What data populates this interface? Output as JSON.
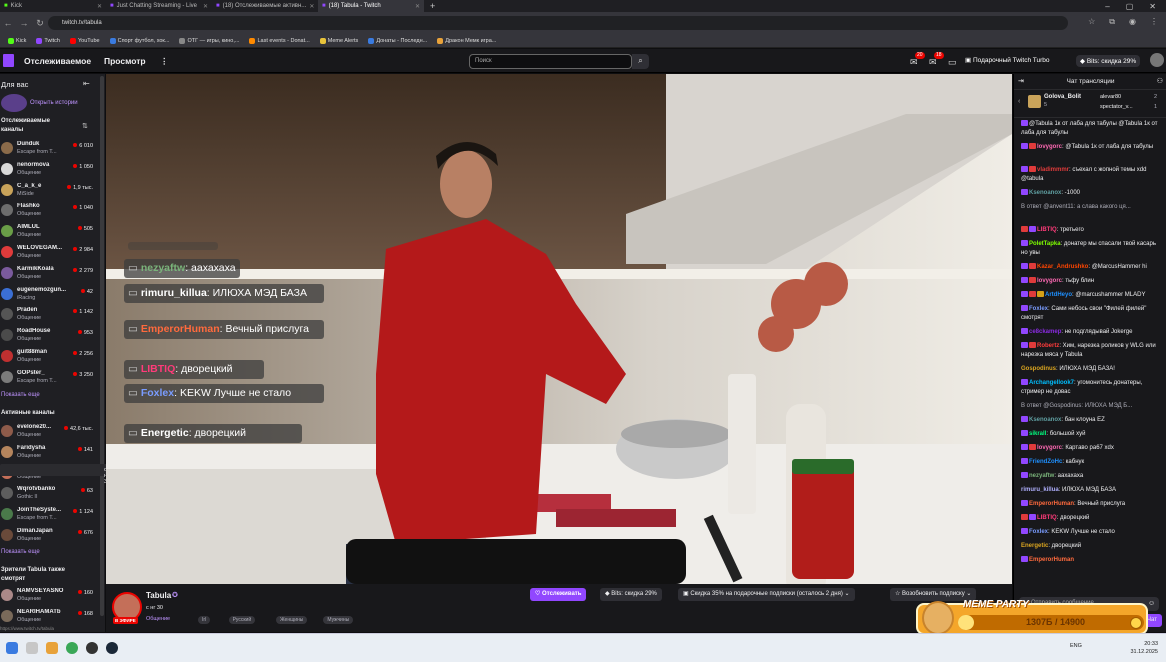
{
  "browser": {
    "tabs": [
      {
        "label": "Kick",
        "active": false
      },
      {
        "label": "Just Chatting Streaming - Live",
        "active": false
      },
      {
        "label": "(18) Отслеживаемые активн...",
        "active": false
      },
      {
        "label": "(18) Tabula - Twitch",
        "active": true
      }
    ],
    "url": "twitch.tv/tabula",
    "bookmarks": [
      "Kick",
      "Twitch",
      "YouTube",
      "Спорт футбол, хок...",
      "ОТГ — игры, кино,...",
      "Last events - Donat...",
      "Meme Alerts",
      "Донаты - Последн...",
      "Дракон Мемк игра..."
    ]
  },
  "topnav": {
    "following": "Отслеживаемое",
    "browse": "Просмотр",
    "more": "⋮",
    "search_placeholder": "Поиск",
    "badge1": "20",
    "badge2": "18",
    "turbo": "Подарочный Twitch Turbo",
    "bits": "Bits: скидка 29%"
  },
  "sidebar": {
    "for_you": "Для вас",
    "collapse": "⇤",
    "open_history": "Открыть истории",
    "followed_title": "Отслеживаемые каналы",
    "followed": [
      {
        "name": "Dunduk",
        "game": "Escape from T...",
        "viewers": "6 010",
        "color": "#8b6b4a"
      },
      {
        "name": "nenormova",
        "game": "Общение",
        "viewers": "1 050",
        "color": "#d9d9d9"
      },
      {
        "name": "C_a_k_e",
        "game": "MiSide",
        "viewers": "1,9 тыс.",
        "color": "#c9a35a"
      },
      {
        "name": "Flashko",
        "game": "Общение",
        "viewers": "1 040",
        "color": "#6d6d6d"
      },
      {
        "name": "AIMLUL",
        "game": "Общение",
        "viewers": "505",
        "color": "#6a9e47"
      },
      {
        "name": "WELOVEGAM...",
        "game": "Общение",
        "viewers": "2 984",
        "color": "#e03b3b"
      },
      {
        "name": "KarmikKoala",
        "game": "Общение",
        "viewers": "2 279",
        "color": "#7a5a9c"
      },
      {
        "name": "eugenemozgun...",
        "game": "iRacing",
        "viewers": "42",
        "color": "#3b6fd4"
      },
      {
        "name": "Praden",
        "game": "Общение",
        "viewers": "1 142",
        "color": "#555"
      },
      {
        "name": "RoadHouse",
        "game": "Общение",
        "viewers": "953",
        "color": "#4b4b4b"
      },
      {
        "name": "guit88man",
        "game": "Общение",
        "viewers": "2 256",
        "color": "#c03030"
      },
      {
        "name": "GOPster_",
        "game": "Escape from T...",
        "viewers": "3 250",
        "color": "#7b7b7b"
      }
    ],
    "show_more1": "Показать еще",
    "active_title": "Активные каналы",
    "active": [
      {
        "name": "evelone20...",
        "game": "Общение",
        "viewers": "42,6 тыс.",
        "color": "#8e5b4a"
      },
      {
        "name": "Faridysha",
        "game": "Общение",
        "viewers": "141",
        "color": "#b5855d"
      },
      {
        "name": "Tabula",
        "game": "Общение",
        "viewers": "269",
        "color": "#c46f59"
      },
      {
        "name": "Wqrotvbanko",
        "game": "Gothic II",
        "viewers": "63",
        "color": "#5d5d5d"
      },
      {
        "name": "JoinTheSyste...",
        "game": "Escape from T...",
        "viewers": "1 124",
        "color": "#4a7a4a"
      },
      {
        "name": "DimanJapan",
        "game": "Общение",
        "viewers": "676",
        "color": "#6a4a3a"
      }
    ],
    "tooltip": "с нг 30",
    "show_more2": "Показать еще",
    "viewers_title": "Зрители Tabula также смотрят",
    "also": [
      {
        "name": "NAMVSEYASNO",
        "game": "Общение",
        "viewers": "160",
        "color": "#a88"
      },
      {
        "name": "NEARIHAMATb",
        "game": "Общение",
        "viewers": "168",
        "color": "#7a6a5a"
      }
    ],
    "status_url": "https://www.twitch.tv/tabula"
  },
  "overlay_chat": [
    {
      "user": "nezyaftw",
      "text": ": аахахаха",
      "color": "#7ab37a"
    },
    {
      "user": "rimuru_killua",
      "text": ": ИЛЮХА МЭД БАЗА",
      "color": "#ffffff"
    },
    {
      "user": "EmperorHuman",
      "text": ": Вечный прислуга",
      "color": "#ff6a3d"
    },
    {
      "user": "LIBTIQ",
      "text": ": дворецкий",
      "color": "#ff3b7a"
    },
    {
      "user": "Foxlex",
      "text": ": KEKW Лучше не стало",
      "color": "#7a9cff"
    },
    {
      "user": "Energetic",
      "text": ": дворецкий",
      "color": "#ffffff"
    }
  ],
  "stream": {
    "streamer": "Tabula",
    "live": "В ЭФИРЕ",
    "title": "с нг 30",
    "category": "Общение",
    "tags": [
      "Irl",
      "Русский",
      "Женщины",
      "Мужчины"
    ],
    "follow": "Отслеживать",
    "bits_pill": "Bits: скидка 29%",
    "gift_pill": "Скидка 35% на подарочные подписки (осталось 2 дня)",
    "resume_pill": "Возобновить подписку"
  },
  "chat": {
    "header": "Чат трансляции",
    "leaders": [
      {
        "name": "Golova_Bolit",
        "count": "5"
      },
      {
        "name": "alevar80",
        "count": "2"
      },
      {
        "name": "spectator_v...",
        "count": "1"
      }
    ],
    "messages": [
      {
        "user": "",
        "text": "@Tabula 1к от лаба для табулы @Tabula 1к от лаба для табулы",
        "color": "#efeff1",
        "badges": [
          "#9147ff"
        ]
      },
      {
        "user": "lovygorc",
        "text": ": @Tabula 1к от лаба для табулы",
        "color": "#ff69b4",
        "badges": [
          "#9147ff",
          "#e03b3b"
        ]
      },
      {
        "user": "vladimmmr",
        "text": ": съехал с жопной темы xdd @tabula",
        "color": "#e03b3b",
        "badges": [
          "#9147ff",
          "#e03b3b"
        ]
      },
      {
        "user": "Ksenoanox",
        "text": ": -1000",
        "color": "#5f9ea0",
        "badges": [
          "#9147ff"
        ]
      },
      {
        "user": "",
        "text": "В ответ @anvent11: а слава какого ця...",
        "color": "#adadb8",
        "badges": []
      },
      {
        "user": "LIBTIQ",
        "text": ": третьего",
        "color": "#ff3b7a",
        "badges": [
          "#e03b3b",
          "#9147ff"
        ]
      },
      {
        "user": "PoletTapka",
        "text": ": донатер мы спасали твой касарь но увы",
        "color": "#7fff00",
        "badges": [
          "#9147ff"
        ]
      },
      {
        "user": "Kazar_Andrushko",
        "text": ": @MarcusHammer hi",
        "color": "#ff4500",
        "badges": [
          "#9147ff",
          "#e03b3b"
        ]
      },
      {
        "user": "lovygorc",
        "text": ": тьфу блин",
        "color": "#ff69b4",
        "badges": [
          "#9147ff",
          "#e03b3b"
        ]
      },
      {
        "user": "ArtdHeyo",
        "text": ": @marcushammer MLADY",
        "color": "#1e90ff",
        "badges": [
          "#9147ff",
          "#e03b3b",
          "#d4a017"
        ]
      },
      {
        "user": "Foxlex",
        "text": ": Сами небось свои \"Филей филей\" смотрят",
        "color": "#7a9cff",
        "badges": [
          "#9147ff"
        ]
      },
      {
        "user": "ce8ckamep",
        "text": ": не подглядывай Jokerge",
        "color": "#8a2be2",
        "badges": [
          "#9147ff"
        ]
      },
      {
        "user": "Robertz",
        "text": ": Хим, нарезка роликов у WLG или нарезка мяса у Tabula",
        "color": "#ff3b3b",
        "badges": [
          "#9147ff",
          "#e03b3b"
        ]
      },
      {
        "user": "Gospodinus",
        "text": ": ИЛЮХА МЭД БАЗА!",
        "color": "#daa520",
        "badges": []
      },
      {
        "user": "Archangellook7",
        "text": ": угомонитесь донатеры, стример не довас",
        "color": "#00bfff",
        "badges": [
          "#9147ff"
        ]
      },
      {
        "user": "",
        "text": "В ответ @Gospodinus: ИЛЮХА МЭД Б...",
        "color": "#adadb8",
        "badges": []
      },
      {
        "user": "Ksenoanox",
        "text": ": бан клоуна EZ",
        "color": "#5f9ea0",
        "badges": [
          "#9147ff"
        ]
      },
      {
        "user": "sikrall",
        "text": ": большой хуй",
        "color": "#00ff7f",
        "badges": [
          "#9147ff"
        ]
      },
      {
        "user": "lovygorc",
        "text": ": Картаво ра67 xdx",
        "color": "#ff69b4",
        "badges": [
          "#9147ff",
          "#e03b3b"
        ]
      },
      {
        "user": "FriendZoHc",
        "text": ": кабнук",
        "color": "#1e90ff",
        "badges": [
          "#9147ff"
        ]
      },
      {
        "user": "nezyaftw",
        "text": ": аахахаха",
        "color": "#7ab37a",
        "badges": [
          "#9147ff"
        ]
      },
      {
        "user": "rimuru_killua",
        "text": ": ИЛЮХА МЭД БАЗА",
        "color": "#b0b0ff",
        "badges": []
      },
      {
        "user": "EmperorHuman",
        "text": ": Вечный прислуга",
        "color": "#ff6a3d",
        "badges": [
          "#9147ff"
        ]
      },
      {
        "user": "LIBTIQ",
        "text": ": дворецкий",
        "color": "#ff3b7a",
        "badges": [
          "#e03b3b",
          "#9147ff"
        ]
      },
      {
        "user": "Foxlex",
        "text": ": KEKW Лучше не стало",
        "color": "#7a9cff",
        "badges": [
          "#9147ff"
        ]
      },
      {
        "user": "Energetic",
        "text": ": дворецкий",
        "color": "#daa520",
        "badges": []
      },
      {
        "user": "EmperorHuman",
        "text": "",
        "color": "#ff6a3d",
        "badges": [
          "#9147ff"
        ]
      }
    ],
    "input_placeholder": "Отправить сообщение",
    "send": "Чат"
  },
  "meme_party": {
    "title": "MEME PARTY",
    "value": "1307Б / 14900",
    "progress": 0.088
  },
  "taskbar": {
    "lang": "ENG",
    "time": "20:33",
    "date": "31.12.2025"
  }
}
